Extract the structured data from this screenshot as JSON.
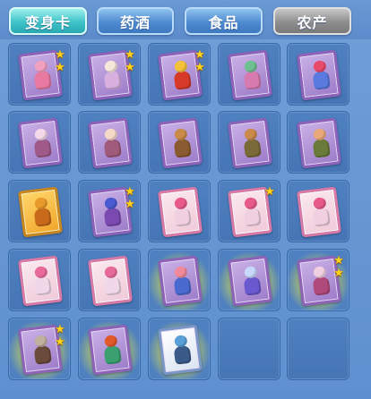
{
  "tabs": [
    {
      "label": "变身卡",
      "state": "active"
    },
    {
      "label": "药酒",
      "state": "normal"
    },
    {
      "label": "食品",
      "state": "normal"
    },
    {
      "label": "农产",
      "state": "gray"
    }
  ],
  "colors": {
    "background": "#6a9ad4",
    "slot": "#4f80c0",
    "tab_active": "#3fc3c8",
    "tab_normal": "#4f8bd0",
    "tab_gray": "#8e8e8e",
    "star": "#ffd21c"
  },
  "inventory": [
    {
      "card": "purple",
      "figure": [
        "#f2a0c0",
        "#e87aa2"
      ],
      "stars": 2,
      "glow": false
    },
    {
      "card": "purple",
      "figure": [
        "#f5e8d8",
        "#d8b0e0"
      ],
      "stars": 2,
      "glow": false
    },
    {
      "card": "purple",
      "figure": [
        "#f4c23a",
        "#d83a2a"
      ],
      "stars": 2,
      "glow": false
    },
    {
      "card": "purple",
      "figure": [
        "#6fc090",
        "#d77ab0"
      ],
      "stars": 0,
      "glow": false
    },
    {
      "card": "purple",
      "figure": [
        "#e84a6a",
        "#5a7ae0"
      ],
      "stars": 0,
      "glow": false
    },
    {
      "card": "purple",
      "figure": [
        "#f2d8e8",
        "#a05a8a"
      ],
      "stars": 0,
      "glow": false
    },
    {
      "card": "purple",
      "figure": [
        "#f5d8c8",
        "#a05a7a"
      ],
      "stars": 0,
      "glow": false
    },
    {
      "card": "purple",
      "figure": [
        "#c98a4a",
        "#8a5a30"
      ],
      "stars": 0,
      "glow": false
    },
    {
      "card": "purple",
      "figure": [
        "#c98a4a",
        "#7a6a3a"
      ],
      "stars": 0,
      "glow": false
    },
    {
      "card": "purple",
      "figure": [
        "#e8a87a",
        "#6a7a3a"
      ],
      "stars": 0,
      "glow": false
    },
    {
      "card": "gold",
      "figure": [
        "#e89a2a",
        "#c86a1a"
      ],
      "stars": 0,
      "glow": false
    },
    {
      "card": "purple",
      "figure": [
        "#4a5ad0",
        "#7a4ab0"
      ],
      "stars": 2,
      "glow": false
    },
    {
      "card": "pink",
      "figure": [
        "#e85a8a",
        "#f0d0e0"
      ],
      "stars": 0,
      "glow": false
    },
    {
      "card": "pink",
      "figure": [
        "#e85a8a",
        "#f0d0e0"
      ],
      "stars": 1,
      "glow": false
    },
    {
      "card": "pink",
      "figure": [
        "#e85a8a",
        "#f0d0e0"
      ],
      "stars": 0,
      "glow": false
    },
    {
      "card": "pink",
      "figure": [
        "#e86a9a",
        "#f0d8e8"
      ],
      "stars": 0,
      "glow": false
    },
    {
      "card": "pink",
      "figure": [
        "#e86a9a",
        "#f0d8e8"
      ],
      "stars": 0,
      "glow": false
    },
    {
      "card": "purple",
      "figure": [
        "#f08a9a",
        "#4a6ad0"
      ],
      "stars": 0,
      "glow": true
    },
    {
      "card": "purple",
      "figure": [
        "#c8d8f8",
        "#6a5ad0"
      ],
      "stars": 0,
      "glow": true
    },
    {
      "card": "purple",
      "figure": [
        "#f0d0e0",
        "#b04a7a"
      ],
      "stars": 2,
      "glow": true
    },
    {
      "card": "purple",
      "figure": [
        "#c0b0a0",
        "#6a4a3a"
      ],
      "stars": 2,
      "glow": true
    },
    {
      "card": "purple",
      "figure": [
        "#e05a2a",
        "#3aa070"
      ],
      "stars": 0,
      "glow": true
    },
    {
      "card": "white",
      "figure": [
        "#5aa0d8",
        "#3a5a8a"
      ],
      "stars": 0,
      "glow": true
    },
    null,
    null
  ]
}
